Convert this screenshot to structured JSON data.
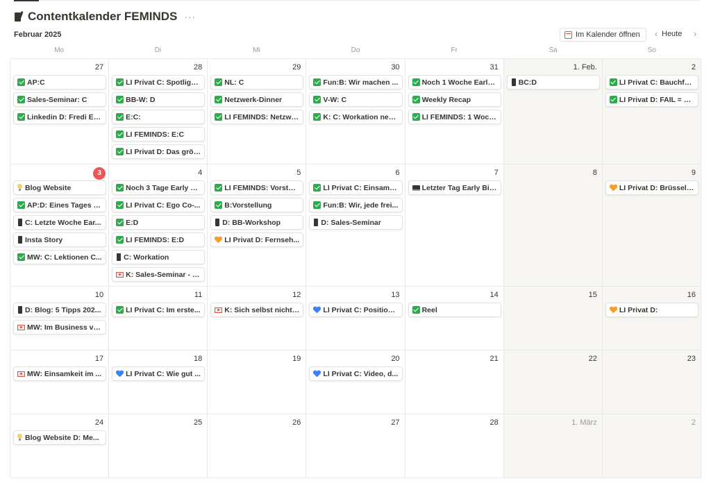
{
  "header": {
    "title": "Contentkalender FEMINDS",
    "more": "···",
    "month_label": "Februar 2025",
    "open_calendar_label": "Im Kalender öffnen",
    "today_label": "Heute",
    "prev_glyph": "‹",
    "next_glyph": "›"
  },
  "weekdays": [
    "Mo",
    "Di",
    "Mi",
    "Do",
    "Fr",
    "Sa",
    "So"
  ],
  "colors": {
    "today_badge": "#eb5757",
    "check": "#2eab4d",
    "weekend_bg": "#f7f6f3"
  },
  "days": [
    {
      "label": "27",
      "cards": [
        {
          "icon": "check",
          "text": "AP:C"
        },
        {
          "icon": "check",
          "text": "Sales-Seminar: C"
        },
        {
          "icon": "check",
          "text": "Linkedin D: Fredi Ev..."
        }
      ]
    },
    {
      "label": "28",
      "cards": [
        {
          "icon": "check",
          "text": "LI Privat C: Spotlight..."
        },
        {
          "icon": "check",
          "text": "BB-W: D"
        },
        {
          "icon": "check",
          "text": "E:C:"
        },
        {
          "icon": "check",
          "text": "LI FEMINDS: E:C"
        },
        {
          "icon": "check",
          "text": "LI Privat D: Das größ..."
        }
      ]
    },
    {
      "label": "29",
      "cards": [
        {
          "icon": "check",
          "text": "NL: C"
        },
        {
          "icon": "check",
          "text": "Netzwerk-Dinner"
        },
        {
          "icon": "check",
          "text": "LI FEMINDS: Netzwe..."
        }
      ]
    },
    {
      "label": "30",
      "cards": [
        {
          "icon": "check",
          "text": "Fun:B: Wir machen ..."
        },
        {
          "icon": "check",
          "text": "V-W: C"
        },
        {
          "icon": "check",
          "text": "K: C: Workation neu..."
        }
      ]
    },
    {
      "label": "31",
      "cards": [
        {
          "icon": "check",
          "text": "Noch 1 Woche Early-..."
        },
        {
          "icon": "check",
          "text": "Weekly Recap"
        },
        {
          "icon": "check",
          "text": "LI FEMINDS: 1 Woch..."
        }
      ]
    },
    {
      "label": "1. Feb.",
      "weekend": true,
      "cards": [
        {
          "icon": "phone",
          "text": "BC:D"
        }
      ]
    },
    {
      "label": "2",
      "weekend": true,
      "cards": [
        {
          "icon": "check",
          "text": "LI Privat C: Bauchfre..."
        },
        {
          "icon": "check",
          "text": "LI Privat D: FAIL = Fa..."
        }
      ]
    },
    {
      "label": "3",
      "today": true,
      "cards": [
        {
          "icon": "bulb",
          "text": "Blog Website"
        },
        {
          "icon": "check",
          "text": "AP:D: Eines Tages w..."
        },
        {
          "icon": "phone",
          "text": "C: Letzte Woche Ear..."
        },
        {
          "icon": "phone",
          "text": "Insta Story"
        },
        {
          "icon": "check",
          "text": "MW: C: Lektionen C..."
        }
      ]
    },
    {
      "label": "4",
      "cards": [
        {
          "icon": "check",
          "text": "Noch 3 Tage Early Bi..."
        },
        {
          "icon": "check",
          "text": "LI Privat C: Ego Co-..."
        },
        {
          "icon": "check",
          "text": "E:D"
        },
        {
          "icon": "check",
          "text": "LI FEMINDS: E:D"
        },
        {
          "icon": "phone",
          "text": "C: Workation"
        },
        {
          "icon": "envelope",
          "text": "K: Sales-Seminar - E..."
        }
      ]
    },
    {
      "label": "5",
      "cards": [
        {
          "icon": "check",
          "text": "LI FEMINDS: Vorstell..."
        },
        {
          "icon": "check",
          "text": "B:Vorstellung"
        },
        {
          "icon": "phone",
          "text": "D: BB-Workshop"
        },
        {
          "icon": "heart-orange",
          "text": "LI Privat D: Fernseh..."
        }
      ]
    },
    {
      "label": "6",
      "cards": [
        {
          "icon": "check",
          "text": "LI Privat C: Einsam g..."
        },
        {
          "icon": "check",
          "text": "Fun:B: Wir, jede frei..."
        },
        {
          "icon": "phone",
          "text": "D: Sales-Seminar"
        }
      ]
    },
    {
      "label": "7",
      "cards": [
        {
          "icon": "computer",
          "text": "Letzter Tag Early Bir..."
        }
      ]
    },
    {
      "label": "8",
      "weekend": true,
      "cards": []
    },
    {
      "label": "9",
      "weekend": true,
      "cards": [
        {
          "icon": "heart-orange",
          "text": "LI Privat D: Brüssel -..."
        }
      ]
    },
    {
      "label": "10",
      "cards": [
        {
          "icon": "phone",
          "text": "D: Blog: 5 Tipps 202..."
        },
        {
          "icon": "envelope",
          "text": "MW: Im Business ve..."
        }
      ]
    },
    {
      "label": "11",
      "cards": [
        {
          "icon": "check",
          "text": "LI Privat C: Im erste..."
        }
      ]
    },
    {
      "label": "12",
      "cards": [
        {
          "icon": "envelope",
          "text": "K: Sich selbst nichts..."
        }
      ]
    },
    {
      "label": "13",
      "cards": [
        {
          "icon": "heart-blue",
          "text": "LI Privat C: Positioni..."
        }
      ]
    },
    {
      "label": "14",
      "cards": [
        {
          "icon": "check",
          "text": "Reel"
        }
      ]
    },
    {
      "label": "15",
      "weekend": true,
      "cards": []
    },
    {
      "label": "16",
      "weekend": true,
      "cards": [
        {
          "icon": "heart-orange",
          "text": "LI Privat D:"
        }
      ]
    },
    {
      "label": "17",
      "cards": [
        {
          "icon": "envelope",
          "text": "MW: Einsamkeit im ..."
        }
      ]
    },
    {
      "label": "18",
      "cards": [
        {
          "icon": "heart-blue",
          "text": "LI Privat C: Wie gut ..."
        }
      ]
    },
    {
      "label": "19",
      "cards": []
    },
    {
      "label": "20",
      "cards": [
        {
          "icon": "heart-blue",
          "text": "LI Privat C: Video, d..."
        }
      ]
    },
    {
      "label": "21",
      "cards": []
    },
    {
      "label": "22",
      "weekend": true,
      "cards": []
    },
    {
      "label": "23",
      "weekend": true,
      "cards": []
    },
    {
      "label": "24",
      "cards": [
        {
          "icon": "bulb",
          "text": "Blog Website D: Me..."
        }
      ]
    },
    {
      "label": "25",
      "cards": []
    },
    {
      "label": "26",
      "cards": []
    },
    {
      "label": "27",
      "cards": []
    },
    {
      "label": "28",
      "cards": []
    },
    {
      "label": "1. März",
      "weekend": true,
      "muted": true,
      "cards": []
    },
    {
      "label": "2",
      "weekend": true,
      "muted": true,
      "cards": []
    }
  ]
}
